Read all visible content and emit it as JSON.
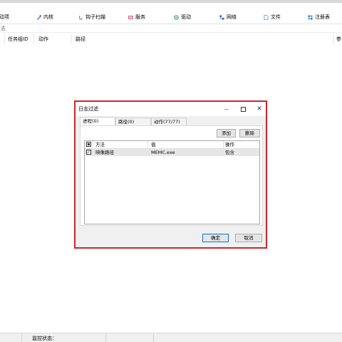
{
  "toolbar": {
    "items": [
      {
        "label": "启动项",
        "icon": "startup-icon",
        "color": "#3a6fd8"
      },
      {
        "label": "内核",
        "icon": "kernel-icon",
        "color": "#1f6fd1"
      },
      {
        "label": "钩子扫描",
        "icon": "hook-icon",
        "color": "#777777"
      },
      {
        "label": "服务",
        "icon": "service-icon",
        "color": "#c8506e"
      },
      {
        "label": "驱动",
        "icon": "driver-icon",
        "color": "#2e8b57"
      },
      {
        "label": "网络",
        "icon": "network-icon",
        "color": "#2a5fb8"
      },
      {
        "label": "文件",
        "icon": "file-icon",
        "color": "#2a8ad3"
      },
      {
        "label": "注册表",
        "icon": "registry-icon",
        "color": "#2a7fc1"
      }
    ]
  },
  "breadcrumb": "日志",
  "columns": [
    "任务组ID",
    "动作",
    "路径",
    "参"
  ],
  "status": {
    "label": "监控状态："
  },
  "dialog": {
    "title": "日志过滤",
    "tabs": [
      "进程(0)",
      "路径(0)",
      "动作(77/77)"
    ],
    "add_label": "添加",
    "delete_label": "删除",
    "list_headers": [
      "方法",
      "值",
      "操作"
    ],
    "rows": [
      {
        "method": "映像路径",
        "value": "MEMC.exe",
        "operation": "包含"
      }
    ],
    "ok_label": "确定",
    "cancel_label": "取消"
  }
}
